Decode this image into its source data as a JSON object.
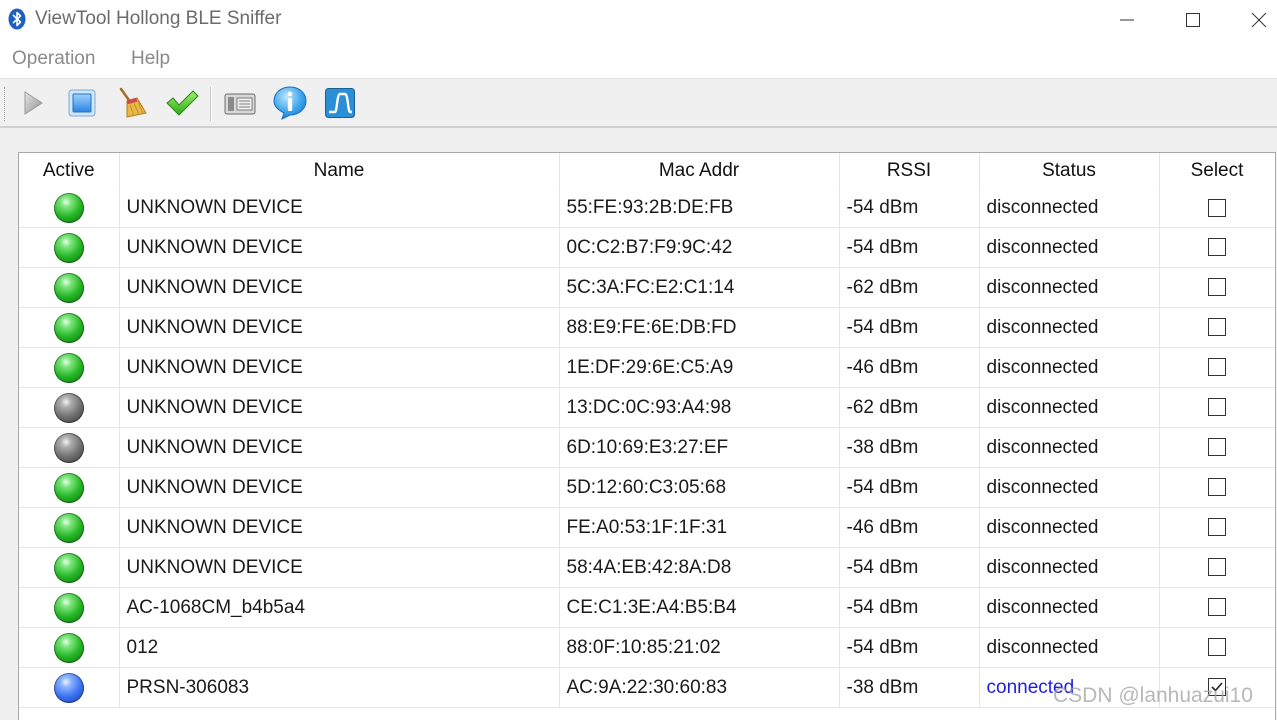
{
  "window": {
    "title": "ViewTool Hollong BLE Sniffer",
    "app_icon": "bluetooth-icon"
  },
  "menu": {
    "items": [
      {
        "label": "Operation"
      },
      {
        "label": "Help"
      }
    ]
  },
  "toolbar": {
    "buttons": [
      {
        "name": "start-button",
        "icon": "play-icon"
      },
      {
        "name": "stop-button",
        "icon": "stop-icon"
      },
      {
        "name": "clear-button",
        "icon": "broom-icon"
      },
      {
        "name": "confirm-button",
        "icon": "checkmark-icon"
      },
      {
        "name": "device-button",
        "icon": "device-icon"
      },
      {
        "name": "info-button",
        "icon": "info-icon"
      },
      {
        "name": "waveform-button",
        "icon": "waveform-icon"
      }
    ]
  },
  "table": {
    "columns": [
      "Active",
      "Name",
      "Mac Addr",
      "RSSI",
      "Status",
      "Select"
    ],
    "rows": [
      {
        "active": "green",
        "name": "UNKNOWN DEVICE",
        "mac": "55:FE:93:2B:DE:FB",
        "rssi": "-54 dBm",
        "status": "disconnected",
        "selected": false
      },
      {
        "active": "green",
        "name": "UNKNOWN DEVICE",
        "mac": "0C:C2:B7:F9:9C:42",
        "rssi": "-54 dBm",
        "status": "disconnected",
        "selected": false
      },
      {
        "active": "green",
        "name": "UNKNOWN DEVICE",
        "mac": "5C:3A:FC:E2:C1:14",
        "rssi": "-62 dBm",
        "status": "disconnected",
        "selected": false
      },
      {
        "active": "green",
        "name": "UNKNOWN DEVICE",
        "mac": "88:E9:FE:6E:DB:FD",
        "rssi": "-54 dBm",
        "status": "disconnected",
        "selected": false
      },
      {
        "active": "green",
        "name": "UNKNOWN DEVICE",
        "mac": "1E:DF:29:6E:C5:A9",
        "rssi": "-46 dBm",
        "status": "disconnected",
        "selected": false
      },
      {
        "active": "gray",
        "name": "UNKNOWN DEVICE",
        "mac": "13:DC:0C:93:A4:98",
        "rssi": "-62 dBm",
        "status": "disconnected",
        "selected": false
      },
      {
        "active": "gray",
        "name": "UNKNOWN DEVICE",
        "mac": "6D:10:69:E3:27:EF",
        "rssi": "-38 dBm",
        "status": "disconnected",
        "selected": false
      },
      {
        "active": "green",
        "name": "UNKNOWN DEVICE",
        "mac": "5D:12:60:C3:05:68",
        "rssi": "-54 dBm",
        "status": "disconnected",
        "selected": false
      },
      {
        "active": "green",
        "name": "UNKNOWN DEVICE",
        "mac": "FE:A0:53:1F:1F:31",
        "rssi": "-46 dBm",
        "status": "disconnected",
        "selected": false
      },
      {
        "active": "green",
        "name": "UNKNOWN DEVICE",
        "mac": "58:4A:EB:42:8A:D8",
        "rssi": "-54 dBm",
        "status": "disconnected",
        "selected": false
      },
      {
        "active": "green",
        "name": "AC-1068CM_b4b5a4",
        "mac": "CE:C1:3E:A4:B5:B4",
        "rssi": "-54 dBm",
        "status": "disconnected",
        "selected": false
      },
      {
        "active": "green",
        "name": "012",
        "mac": "88:0F:10:85:21:02",
        "rssi": "-54 dBm",
        "status": "disconnected",
        "selected": false
      },
      {
        "active": "blue",
        "name": "PRSN-306083",
        "mac": "AC:9A:22:30:60:83",
        "rssi": "-38 dBm",
        "status": "connected",
        "selected": true
      }
    ]
  },
  "colors": {
    "active_green": "#22b422",
    "inactive_gray": "#6e6e6e",
    "connected_blue": "#3a6ff2",
    "connected_text": "#1e1edc"
  },
  "watermark": "CSDN @lanhuazui10"
}
